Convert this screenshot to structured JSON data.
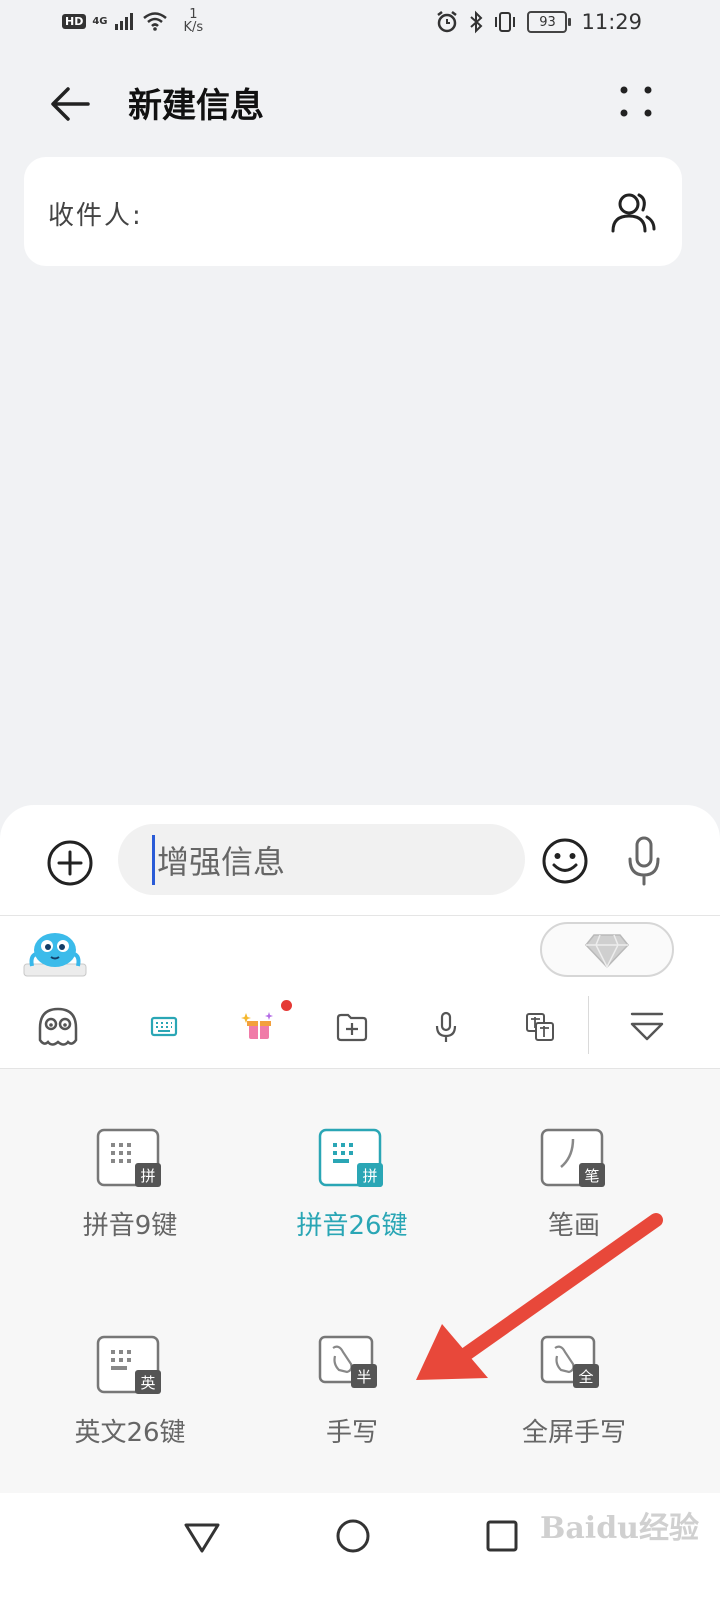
{
  "status_bar": {
    "hd_badge": "HD",
    "network_label": "4G",
    "speed_value": "1",
    "speed_unit": "K/s",
    "battery": "93",
    "time": "11:29"
  },
  "header": {
    "title": "新建信息"
  },
  "recipient": {
    "label": "收件人:"
  },
  "composer": {
    "placeholder": "增强信息"
  },
  "keyboard": {
    "options": [
      {
        "label": "拼音9键",
        "badge": "拼",
        "active": false
      },
      {
        "label": "拼音26键",
        "badge": "拼",
        "active": true
      },
      {
        "label": "笔画",
        "badge": "笔",
        "active": false
      },
      {
        "label": "英文26键",
        "badge": "英",
        "active": false
      },
      {
        "label": "手写",
        "badge": "半",
        "active": false
      },
      {
        "label": "全屏手写",
        "badge": "全",
        "active": false
      }
    ],
    "toolbar_icons": [
      "mascot-face-icon",
      "keyboard-icon",
      "sparkle-gift-icon",
      "folder-add-icon",
      "microphone-icon",
      "pinyin-handwrite-icon",
      "collapse-keyboard-icon"
    ]
  },
  "annotation": {
    "arrow_color": "#e8483a"
  },
  "colors": {
    "accent": "#2aa6b5",
    "caret": "#2a5bd7"
  },
  "watermark": {
    "text": "Baidu经验"
  }
}
